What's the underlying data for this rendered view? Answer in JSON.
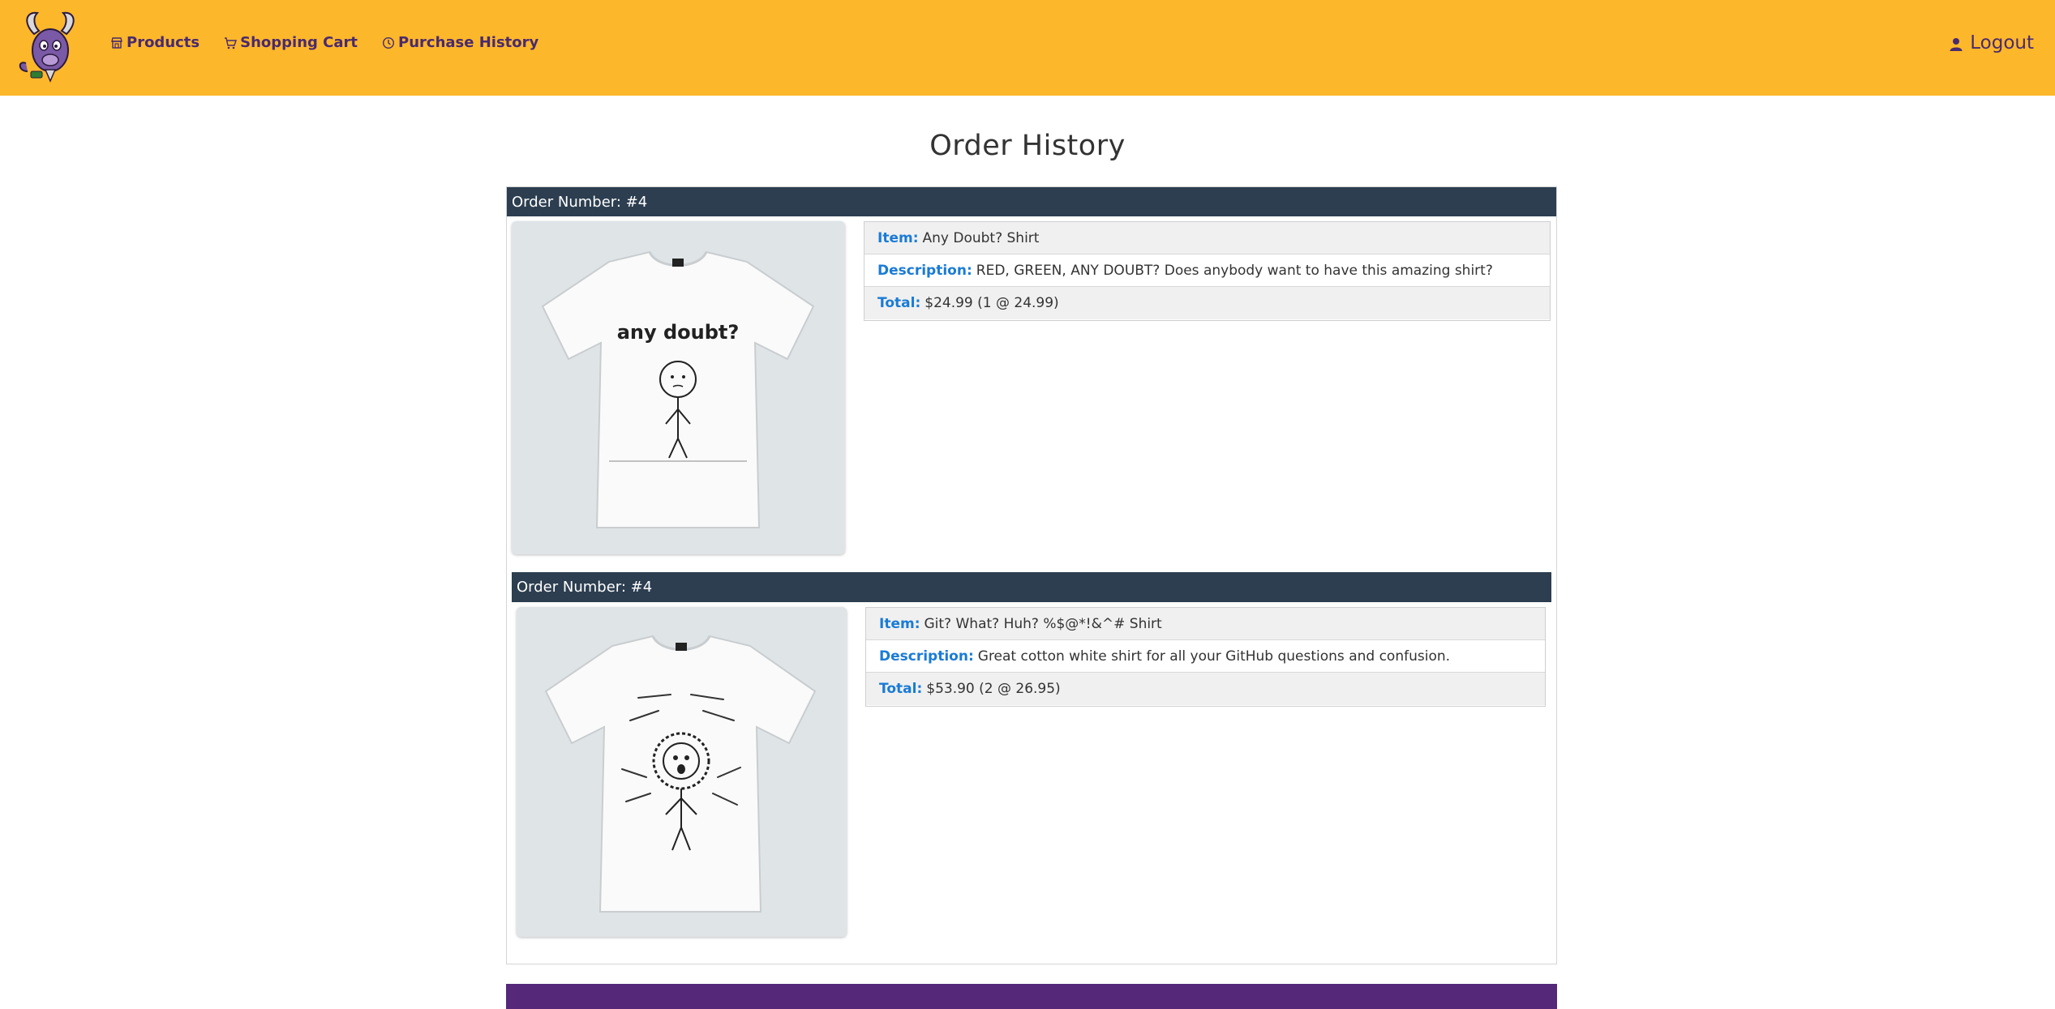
{
  "nav": {
    "links": [
      {
        "label": "Products",
        "icon": "store-icon"
      },
      {
        "label": "Shopping Cart",
        "icon": "cart-icon"
      },
      {
        "label": "Purchase History",
        "icon": "clock-icon"
      }
    ],
    "logout_label": "Logout",
    "logout_icon": "user-icon"
  },
  "page": {
    "title": "Order History"
  },
  "orders": [
    {
      "header": "Order Number: #4",
      "item_label": "Item:",
      "item": "Any Doubt? Shirt",
      "description_label": "Description:",
      "description": "RED, GREEN, ANY DOUBT? Does anybody want to have this amazing shirt?",
      "total_label": "Total:",
      "total": "$24.99 (1 @ 24.99)",
      "shirt_text": "any doubt?"
    },
    {
      "header": "Order Number: #4",
      "item_label": "Item:",
      "item": "Git? What? Huh? %$@*!&^# Shirt",
      "description_label": "Description:",
      "description": "Great cotton white shirt for all your GitHub questions and confusion.",
      "total_label": "Total:",
      "total": "$53.90 (2 @ 26.95)"
    }
  ],
  "colors": {
    "navbar": "#fdb72b",
    "nav_text": "#4a2a6e",
    "order_header": "#2c3e50",
    "label_blue": "#1a7bd6",
    "footer": "#55287a"
  }
}
